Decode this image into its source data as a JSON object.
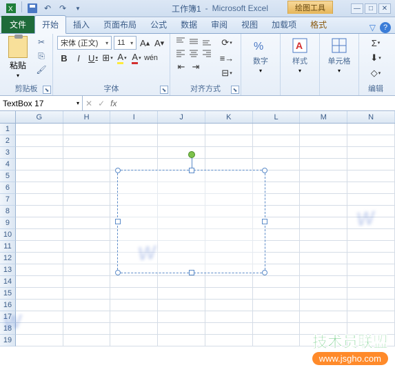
{
  "title": {
    "doc": "工作簿1",
    "app": "Microsoft Excel",
    "contextual": "绘图工具"
  },
  "tabs": {
    "file": "文件",
    "list": [
      "开始",
      "插入",
      "页面布局",
      "公式",
      "数据",
      "审阅",
      "视图",
      "加载项"
    ],
    "context": "格式",
    "active_index": 0
  },
  "ribbon": {
    "clipboard": {
      "paste": "粘贴",
      "label": "剪贴板"
    },
    "font": {
      "name": "宋体 (正文)",
      "size": "11",
      "bold": "B",
      "italic": "I",
      "underline": "U",
      "label": "字体"
    },
    "alignment": {
      "wrap": "≡",
      "merge": "国",
      "label": "对齐方式"
    },
    "number": {
      "label": "数字"
    },
    "styles": {
      "label": "样式"
    },
    "cells": {
      "label": "单元格"
    },
    "editing": {
      "sigma": "Σ",
      "label": "编辑"
    }
  },
  "formula": {
    "name_box": "TextBox 17",
    "fx": "fx"
  },
  "grid": {
    "cols": [
      "G",
      "H",
      "I",
      "J",
      "K",
      "L",
      "M",
      "N"
    ],
    "rows": [
      "1",
      "2",
      "3",
      "4",
      "5",
      "6",
      "7",
      "8",
      "9",
      "10",
      "11",
      "12",
      "13",
      "14",
      "15",
      "16",
      "17",
      "18",
      "19"
    ]
  },
  "watermark": {
    "line1": "技术员联盟",
    "line2": "www.jsgho.com"
  }
}
